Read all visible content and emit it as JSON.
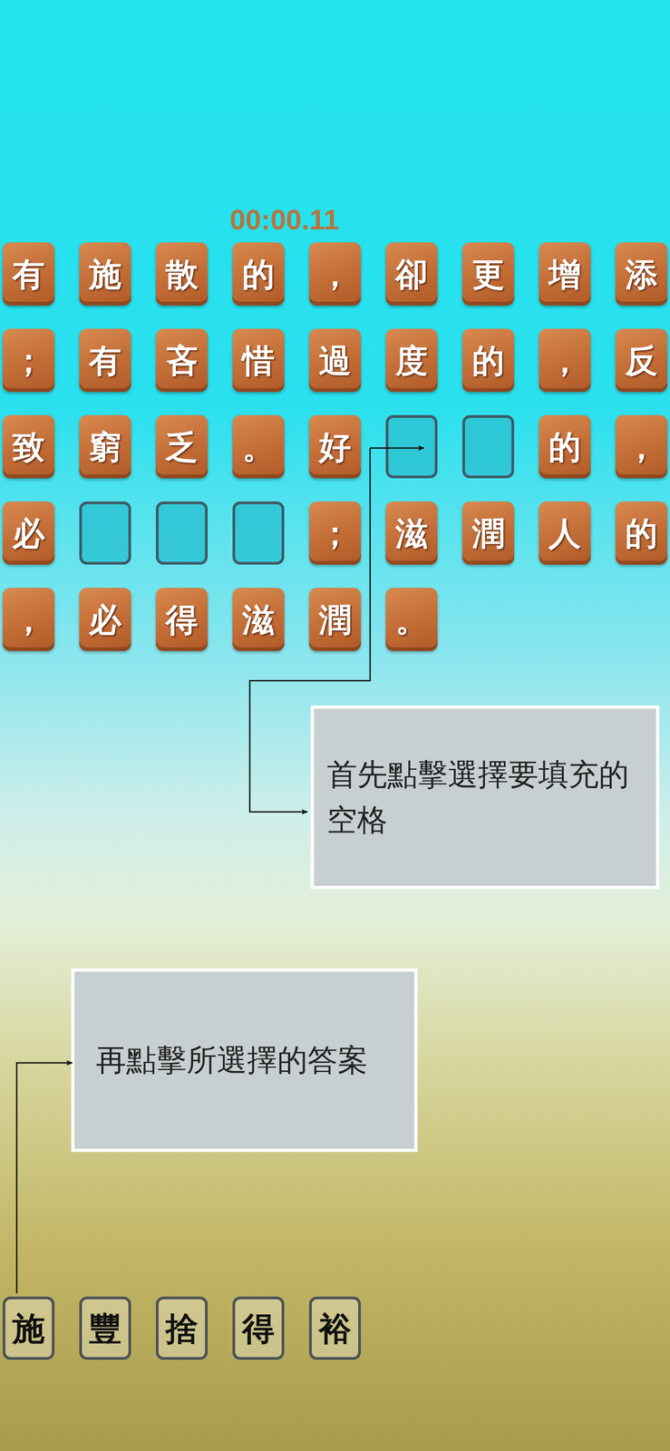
{
  "timer": "00:00.11",
  "puzzle": {
    "cells": [
      {
        "kind": "letter",
        "text": "有"
      },
      {
        "kind": "letter",
        "text": "施"
      },
      {
        "kind": "letter",
        "text": "散"
      },
      {
        "kind": "letter",
        "text": "的"
      },
      {
        "kind": "letter",
        "text": "，"
      },
      {
        "kind": "letter",
        "text": "卻"
      },
      {
        "kind": "letter",
        "text": "更"
      },
      {
        "kind": "letter",
        "text": "增"
      },
      {
        "kind": "letter",
        "text": "添"
      },
      {
        "kind": "letter",
        "text": "；"
      },
      {
        "kind": "letter",
        "text": "有"
      },
      {
        "kind": "letter",
        "text": "吝"
      },
      {
        "kind": "letter",
        "text": "惜"
      },
      {
        "kind": "letter",
        "text": "過"
      },
      {
        "kind": "letter",
        "text": "度"
      },
      {
        "kind": "letter",
        "text": "的"
      },
      {
        "kind": "letter",
        "text": "，"
      },
      {
        "kind": "letter",
        "text": "反"
      },
      {
        "kind": "letter",
        "text": "致"
      },
      {
        "kind": "letter",
        "text": "窮"
      },
      {
        "kind": "letter",
        "text": "乏"
      },
      {
        "kind": "letter",
        "text": "。"
      },
      {
        "kind": "letter",
        "text": "好"
      },
      {
        "kind": "blank"
      },
      {
        "kind": "blank"
      },
      {
        "kind": "letter",
        "text": "的"
      },
      {
        "kind": "letter",
        "text": "，"
      },
      {
        "kind": "letter",
        "text": "必"
      },
      {
        "kind": "blank"
      },
      {
        "kind": "blank"
      },
      {
        "kind": "blank"
      },
      {
        "kind": "letter",
        "text": "；"
      },
      {
        "kind": "letter",
        "text": "滋"
      },
      {
        "kind": "letter",
        "text": "潤"
      },
      {
        "kind": "letter",
        "text": "人"
      },
      {
        "kind": "letter",
        "text": "的"
      },
      {
        "kind": "letter",
        "text": "，"
      },
      {
        "kind": "letter",
        "text": "必"
      },
      {
        "kind": "letter",
        "text": "得"
      },
      {
        "kind": "letter",
        "text": "滋"
      },
      {
        "kind": "letter",
        "text": "潤"
      },
      {
        "kind": "letter",
        "text": "。"
      }
    ]
  },
  "hints": [
    {
      "text": "首先點擊選擇要填充的空格"
    },
    {
      "text": "再點擊所選擇的答案"
    }
  ],
  "answers": [
    {
      "text": "施"
    },
    {
      "text": "豐"
    },
    {
      "text": "捨"
    },
    {
      "text": "得"
    },
    {
      "text": "裕"
    }
  ]
}
